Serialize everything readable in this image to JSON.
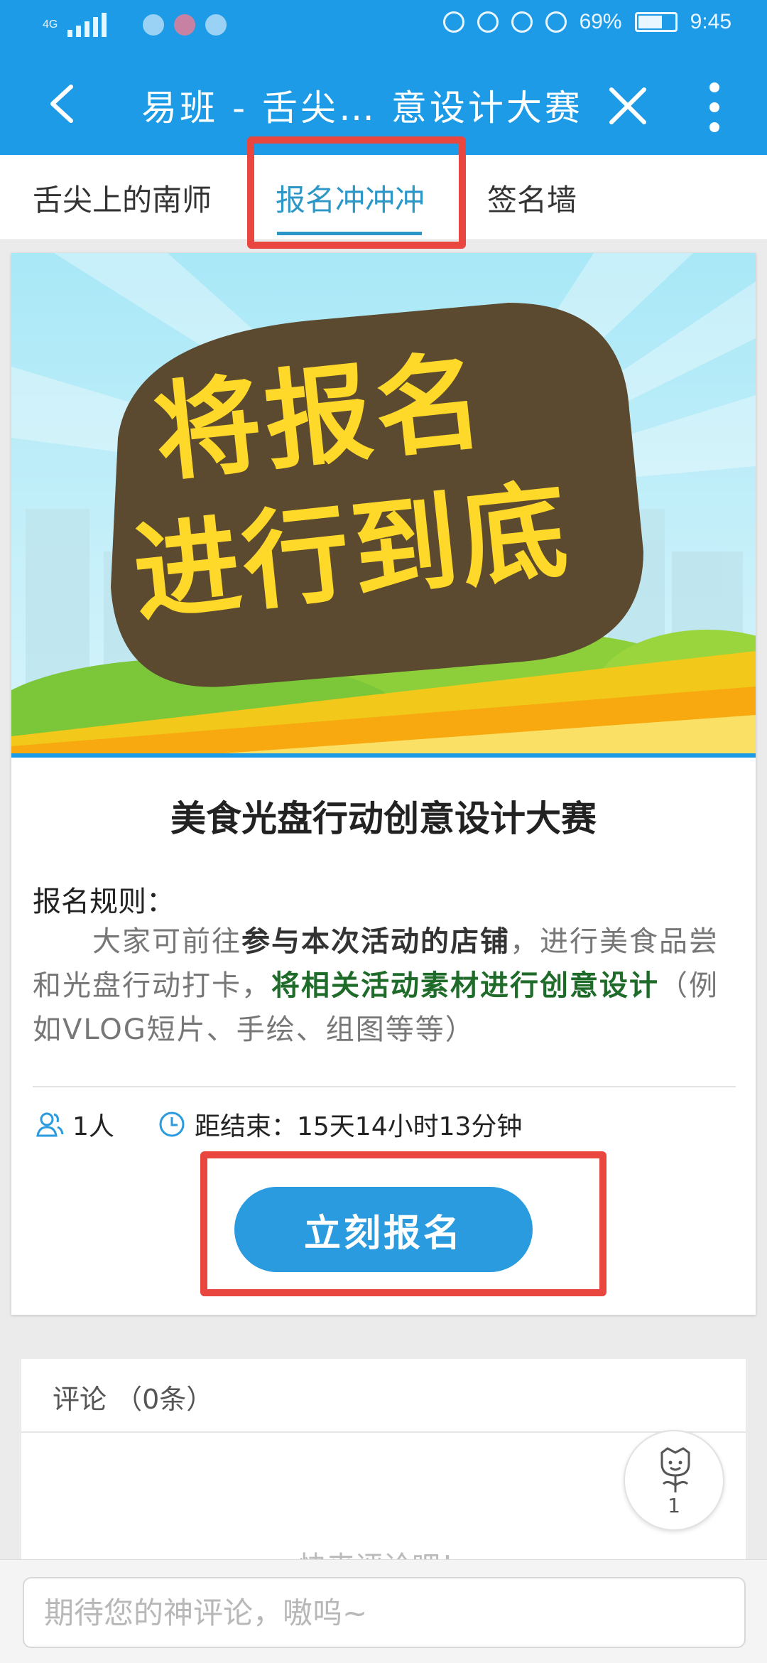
{
  "status_bar": {
    "network": "4G",
    "battery": "69%",
    "time": "9:45"
  },
  "app_bar": {
    "title": "易班 - 舌尖… 意设计大赛",
    "back_icon": "back-arrow-icon",
    "close_icon": "close-icon",
    "more_icon": "more-vertical-icon"
  },
  "tabs": [
    {
      "label": "舌尖上的南师",
      "active": false
    },
    {
      "label": "报名冲冲冲",
      "active": true
    },
    {
      "label": "签名墙",
      "active": false
    }
  ],
  "banner": {
    "line1": "将报名",
    "line2": "进行到底"
  },
  "contest": {
    "title": "美食光盘行动创意设计大赛",
    "rules_label": "报名规则：",
    "rules_text": {
      "part1": "大家可前往",
      "bold1": "参与本次活动的店铺",
      "part2": "，进行美食品尝和光盘行动打卡，",
      "bold2": "将相关活动素材进行创意设计",
      "part3": "（例如VLOG短片、手绘、组图等等）"
    },
    "participants": "1人",
    "countdown": "距结束：15天14小时13分钟",
    "signup_label": "立刻报名"
  },
  "comments": {
    "header": "评论 （0条）",
    "empty_text": "快来评论吧！",
    "like_count": "1"
  },
  "input": {
    "placeholder": "期待您的神评论，嗷呜~"
  },
  "colors": {
    "brand_blue": "#1e9be6",
    "button_blue": "#2a9bdf",
    "highlight_red": "#e8463e",
    "active_tab": "#2d97c8",
    "green_text": "#1f6b2a"
  }
}
